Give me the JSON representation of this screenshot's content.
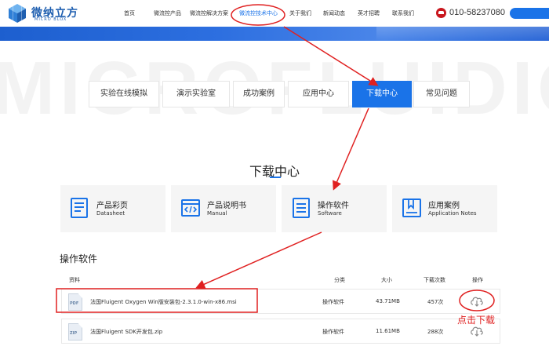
{
  "header": {
    "logo_text": "微纳立方",
    "logo_sub": "MICRO BLOX",
    "nav": [
      {
        "label": "首页"
      },
      {
        "label": "微流控产品"
      },
      {
        "label": "微流控解决方案"
      },
      {
        "label": "微流控技术中心"
      },
      {
        "label": "关于我们"
      },
      {
        "label": "新闻动态"
      },
      {
        "label": "英才招聘"
      },
      {
        "label": "联系我们"
      }
    ],
    "phone": "010-58237080"
  },
  "watermark": "MICROFLUIDIC",
  "tabs": [
    {
      "label": "实验在线模拟"
    },
    {
      "label": "演示实验室"
    },
    {
      "label": "成功案例"
    },
    {
      "label": "应用中心"
    },
    {
      "label": "下载中心"
    },
    {
      "label": "常见问题"
    }
  ],
  "section_title": "下载中心",
  "cards": [
    {
      "title": "产品彩页",
      "sub": "Datasheet",
      "icon": "document-lines-icon"
    },
    {
      "title": "产品说明书",
      "sub": "Manual",
      "icon": "code-window-icon"
    },
    {
      "title": "操作软件",
      "sub": "Software",
      "icon": "list-document-icon"
    },
    {
      "title": "应用案例",
      "sub": "Application Notes",
      "icon": "bookmark-book-icon"
    }
  ],
  "list_title": "操作软件",
  "table": {
    "headers": [
      "资料",
      "分类",
      "大小",
      "下载次数",
      "操作"
    ],
    "rows": [
      {
        "type": "PDF",
        "name": "法国Fluigent Oxygen Win版安装包-2.3.1.0-win-x86.msi",
        "category": "操作软件",
        "size": "43.71MB",
        "downloads": "457次"
      },
      {
        "type": "ZIP",
        "name": "法国Fluigent SDK开发包.zip",
        "category": "操作软件",
        "size": "11.61MB",
        "downloads": "288次"
      }
    ]
  },
  "annotation": {
    "text": "点击下载",
    "color": "#e02020"
  },
  "colors": {
    "accent": "#1a73e8",
    "annotation": "#e02020",
    "brand": "#1f5fb0"
  }
}
